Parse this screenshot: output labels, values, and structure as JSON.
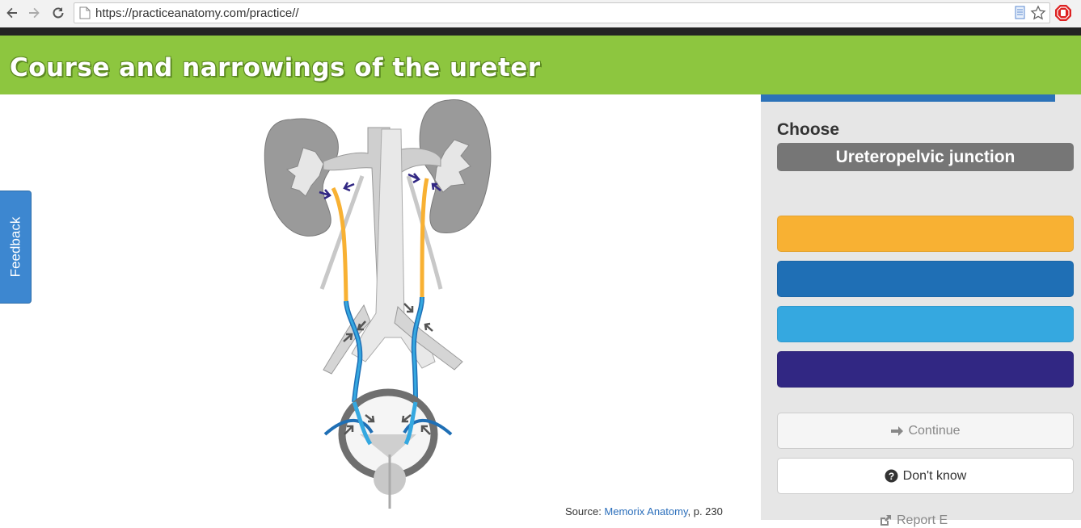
{
  "browser": {
    "url": "https://practiceanatomy.com/practice//"
  },
  "header": {
    "title": "Course and narrowings of the ureter"
  },
  "feedback": {
    "label": "Feedback"
  },
  "figure": {
    "source_prefix": "Source: ",
    "source_link": "Memorix Anatomy",
    "source_suffix": ", p. 230"
  },
  "panel": {
    "progress_fraction": 0.92,
    "choose_label": "Choose",
    "target": "Ureteropelvic junction",
    "options": [
      {
        "color": "#f8b133"
      },
      {
        "color": "#1f6fb5"
      },
      {
        "color": "#35a8e0"
      },
      {
        "color": "#312783"
      }
    ],
    "continue_label": "Continue",
    "dont_know_label": "Don't know",
    "partial_label": "Report E"
  },
  "icons": {
    "back": "arrow-left-icon",
    "forward": "arrow-right-icon",
    "reload": "reload-icon",
    "page": "page-icon",
    "bookmark": "star-icon",
    "extension": "stop-icon",
    "continue": "arrow-right-icon",
    "dont_know": "question-circle-icon"
  }
}
